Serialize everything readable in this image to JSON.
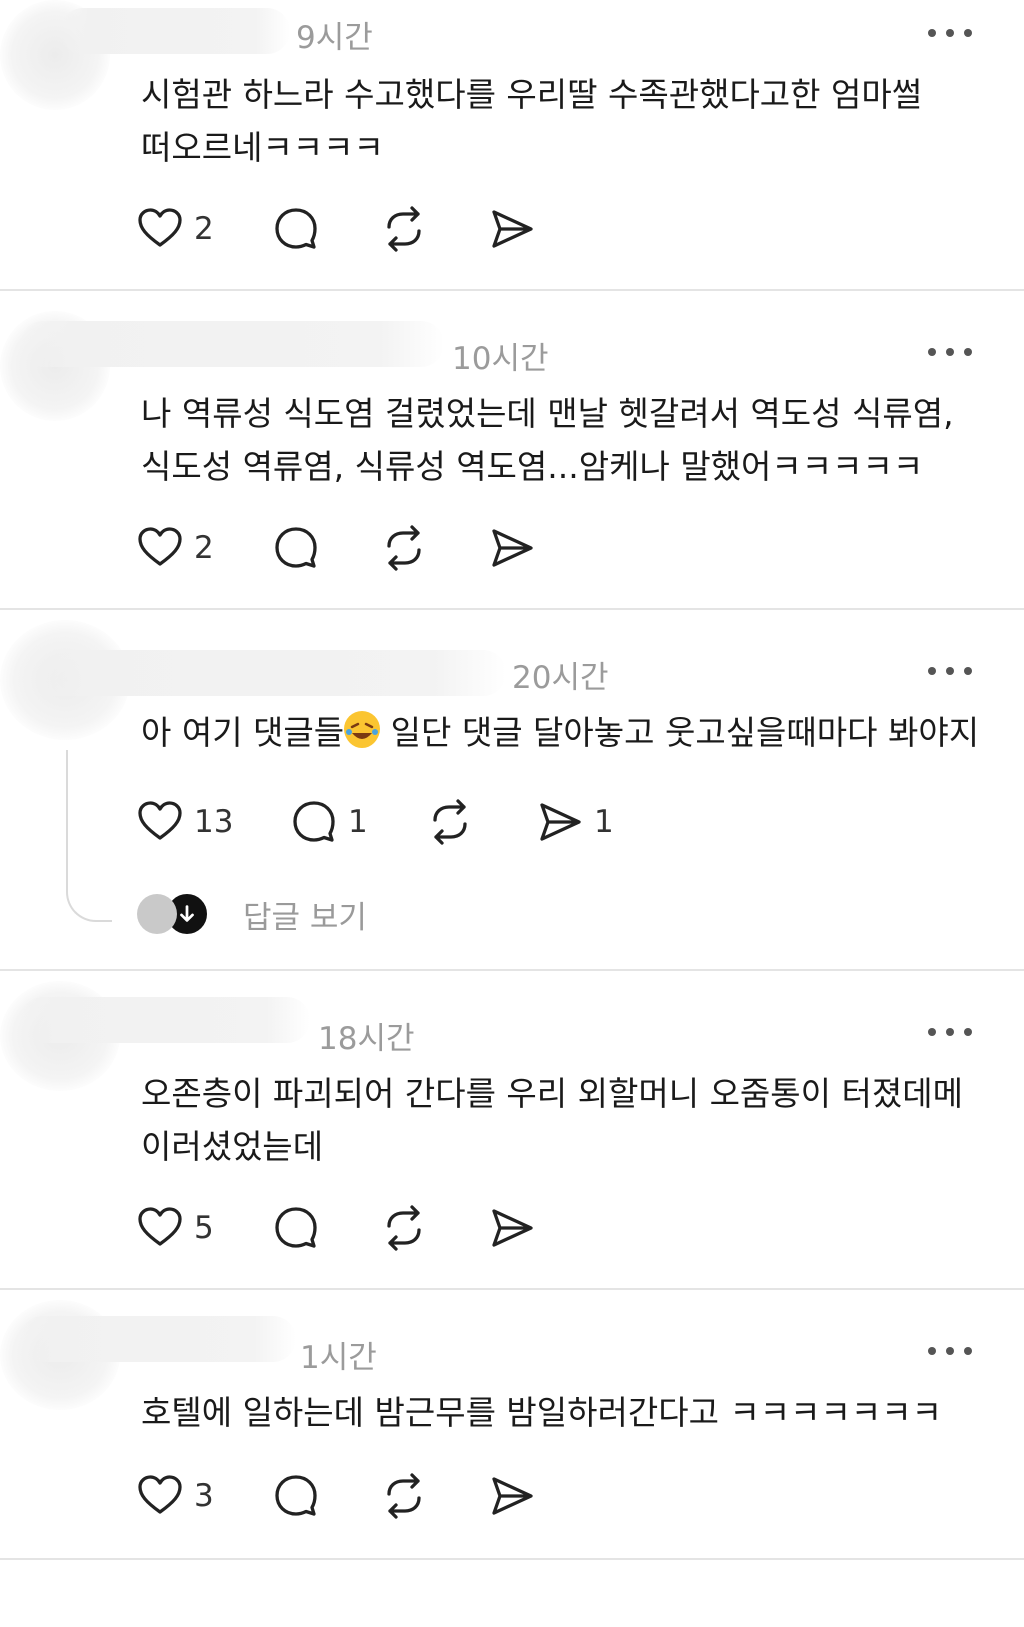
{
  "posts": [
    {
      "time": "9시간",
      "text_lines": [
        "시험관 하느라 수고했다를 우리딸 수족관했다고한 엄마썰",
        "떠오르네ㅋㅋㅋㅋ"
      ],
      "likes": "2",
      "replies": "",
      "reposts": "",
      "shares": ""
    },
    {
      "time": "10시간",
      "text_lines": [
        "나 역류성 식도염 걸렸었는데 맨날 헷갈려서 역도성 식류염,",
        "식도성 역류염, 식류성 역도염...암케나 말했어ㅋㅋㅋㅋㅋ"
      ],
      "likes": "2",
      "replies": "",
      "reposts": "",
      "shares": ""
    },
    {
      "time": "20시간",
      "text_before_emoji": "아 여기 댓글들",
      "emoji": "rolling-on-floor-laughing-emoji",
      "text_after_emoji": " 일단 댓글 달아놓고 웃고싶을때마다 봐야지",
      "likes": "13",
      "replies": "1",
      "reposts": "",
      "shares": "1",
      "view_replies_label": "답글 보기"
    },
    {
      "time": "18시간",
      "text_lines": [
        "오존층이 파괴되어 간다를 우리 외할머니 오줌통이 터졌데메",
        "이러셨었늗데"
      ],
      "likes": "5",
      "replies": "",
      "reposts": "",
      "shares": ""
    },
    {
      "time": "1시간",
      "text_lines": [
        "호텔에 일하는데 밤근무를 밤일하러간다고 ㅋㅋㅋㅋㅋㅋㅋ"
      ],
      "likes": "3",
      "replies": "",
      "reposts": "",
      "shares": ""
    }
  ],
  "icons": {
    "like": "heart-icon",
    "reply": "comment-icon",
    "repost": "repost-icon",
    "share": "send-icon",
    "more": "more-icon"
  }
}
